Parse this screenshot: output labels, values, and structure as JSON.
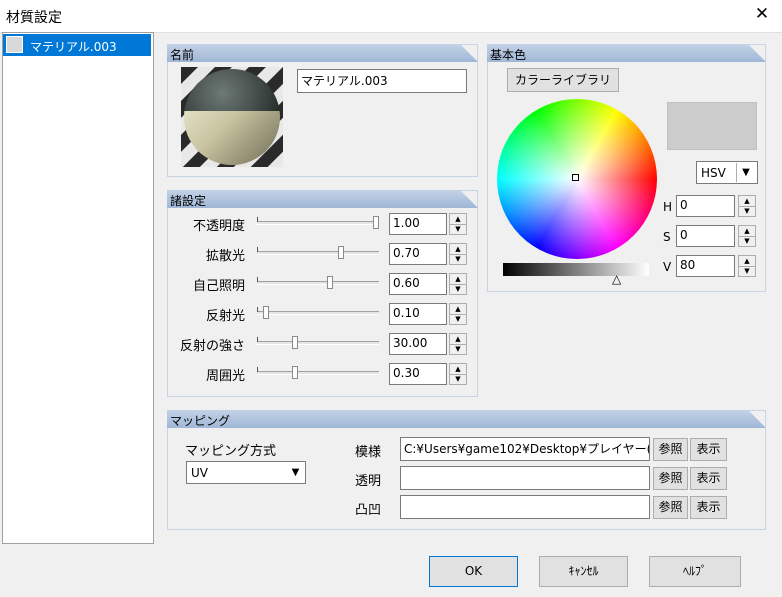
{
  "window": {
    "title": "材質設定",
    "close_glyph": "✕"
  },
  "materials": [
    {
      "name": "マテリアル.003",
      "swatch_color": "#d9d9d9"
    }
  ],
  "name_panel": {
    "title": "名前",
    "name_value": "マテリアル.003"
  },
  "settings_panel": {
    "title": "諸設定",
    "rows": [
      {
        "label": "不透明度",
        "value": "1.00",
        "level": 1.0
      },
      {
        "label": "拡散光",
        "value": "0.70",
        "level": 0.7
      },
      {
        "label": "自己照明",
        "value": "0.60",
        "level": 0.6
      },
      {
        "label": "反射光",
        "value": "0.10",
        "level": 0.05
      },
      {
        "label": "反射の強さ",
        "value": "30.00",
        "level": 0.3
      },
      {
        "label": "周囲光",
        "value": "0.30",
        "level": 0.3
      }
    ]
  },
  "color_panel": {
    "title": "基本色",
    "library_button": "カラーライブラリ",
    "mode": "HSV",
    "preview_color": "#cccccc",
    "fields": [
      {
        "label": "H",
        "value": "0"
      },
      {
        "label": "S",
        "value": "0"
      },
      {
        "label": "V",
        "value": "80"
      }
    ],
    "brightness_marker": "△"
  },
  "mapping_panel": {
    "title": "マッピング",
    "method_label": "マッピング方式",
    "method_value": "UV",
    "rows": [
      {
        "label": "模様",
        "path": "C:¥Users¥game102¥Desktop¥プレイヤー(",
        "ref": "参照",
        "show": "表示"
      },
      {
        "label": "透明",
        "path": "",
        "ref": "参照",
        "show": "表示"
      },
      {
        "label": "凸凹",
        "path": "",
        "ref": "参照",
        "show": "表示"
      }
    ]
  },
  "footer": {
    "ok": "OK",
    "cancel": "ｷｬﾝｾﾙ",
    "help": "ﾍﾙﾌﾟ"
  }
}
